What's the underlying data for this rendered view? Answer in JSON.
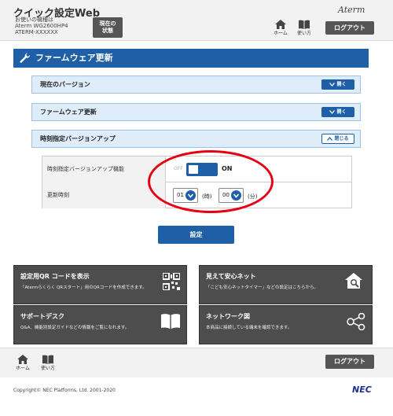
{
  "header": {
    "title": "クイック設定Web",
    "model_label": "お使いの機種は",
    "model_name": "Aterm WG2600HP4",
    "model_serial": "ATERM-XXXXXX",
    "status_button": [
      "現在の",
      "状態"
    ],
    "brand": "Aterm",
    "home_label": "ホーム",
    "manual_label": "使い方",
    "logout_label": "ログアウト"
  },
  "section": {
    "title": "ファームウェア更新"
  },
  "accordions": [
    {
      "label": "現在のバージョン",
      "button": "開く",
      "state": "collapsed"
    },
    {
      "label": "ファームウェア更新",
      "button": "開く",
      "state": "collapsed"
    },
    {
      "label": "時刻指定バージョンアップ",
      "button": "閉じる",
      "state": "expanded"
    }
  ],
  "settings": {
    "auto_update_label": "時刻指定バージョンアップ機能",
    "toggle_off": "OFF",
    "toggle_on": "ON",
    "toggle_value": "ON",
    "update_time_label": "更新時刻",
    "hour_value": "01",
    "hour_unit": "(時)",
    "minute_value": "00",
    "minute_unit": "(分)"
  },
  "apply_label": "設定",
  "tiles": [
    {
      "title": "設定用QR コードを表示",
      "desc": "「Atermらくらく QRスタート」用のQRコードを作成できます。",
      "icon": "qr-code-icon"
    },
    {
      "title": "見えて安心ネット",
      "desc": "「こども安心ネットタイマー」などの設定はこちらから。",
      "icon": "home-search-icon"
    },
    {
      "title": "サポートデスク",
      "desc": "Q&A、機能別設定ガイドなどの情報をご覧になれます。",
      "icon": "book-icon"
    },
    {
      "title": "ネットワーク図",
      "desc": "本商品に接続している端末を確認できます。",
      "icon": "network-icon"
    }
  ],
  "footer": {
    "home_label": "ホーム",
    "manual_label": "使い方",
    "logout_label": "ログアウト",
    "copyright": "Copyright© NEC Platforms, Ltd. 2001-2020",
    "logo": "NEC"
  },
  "colors": {
    "primary": "#1e5fa8",
    "highlight": "#e60012",
    "tile": "#4d4d4d"
  }
}
